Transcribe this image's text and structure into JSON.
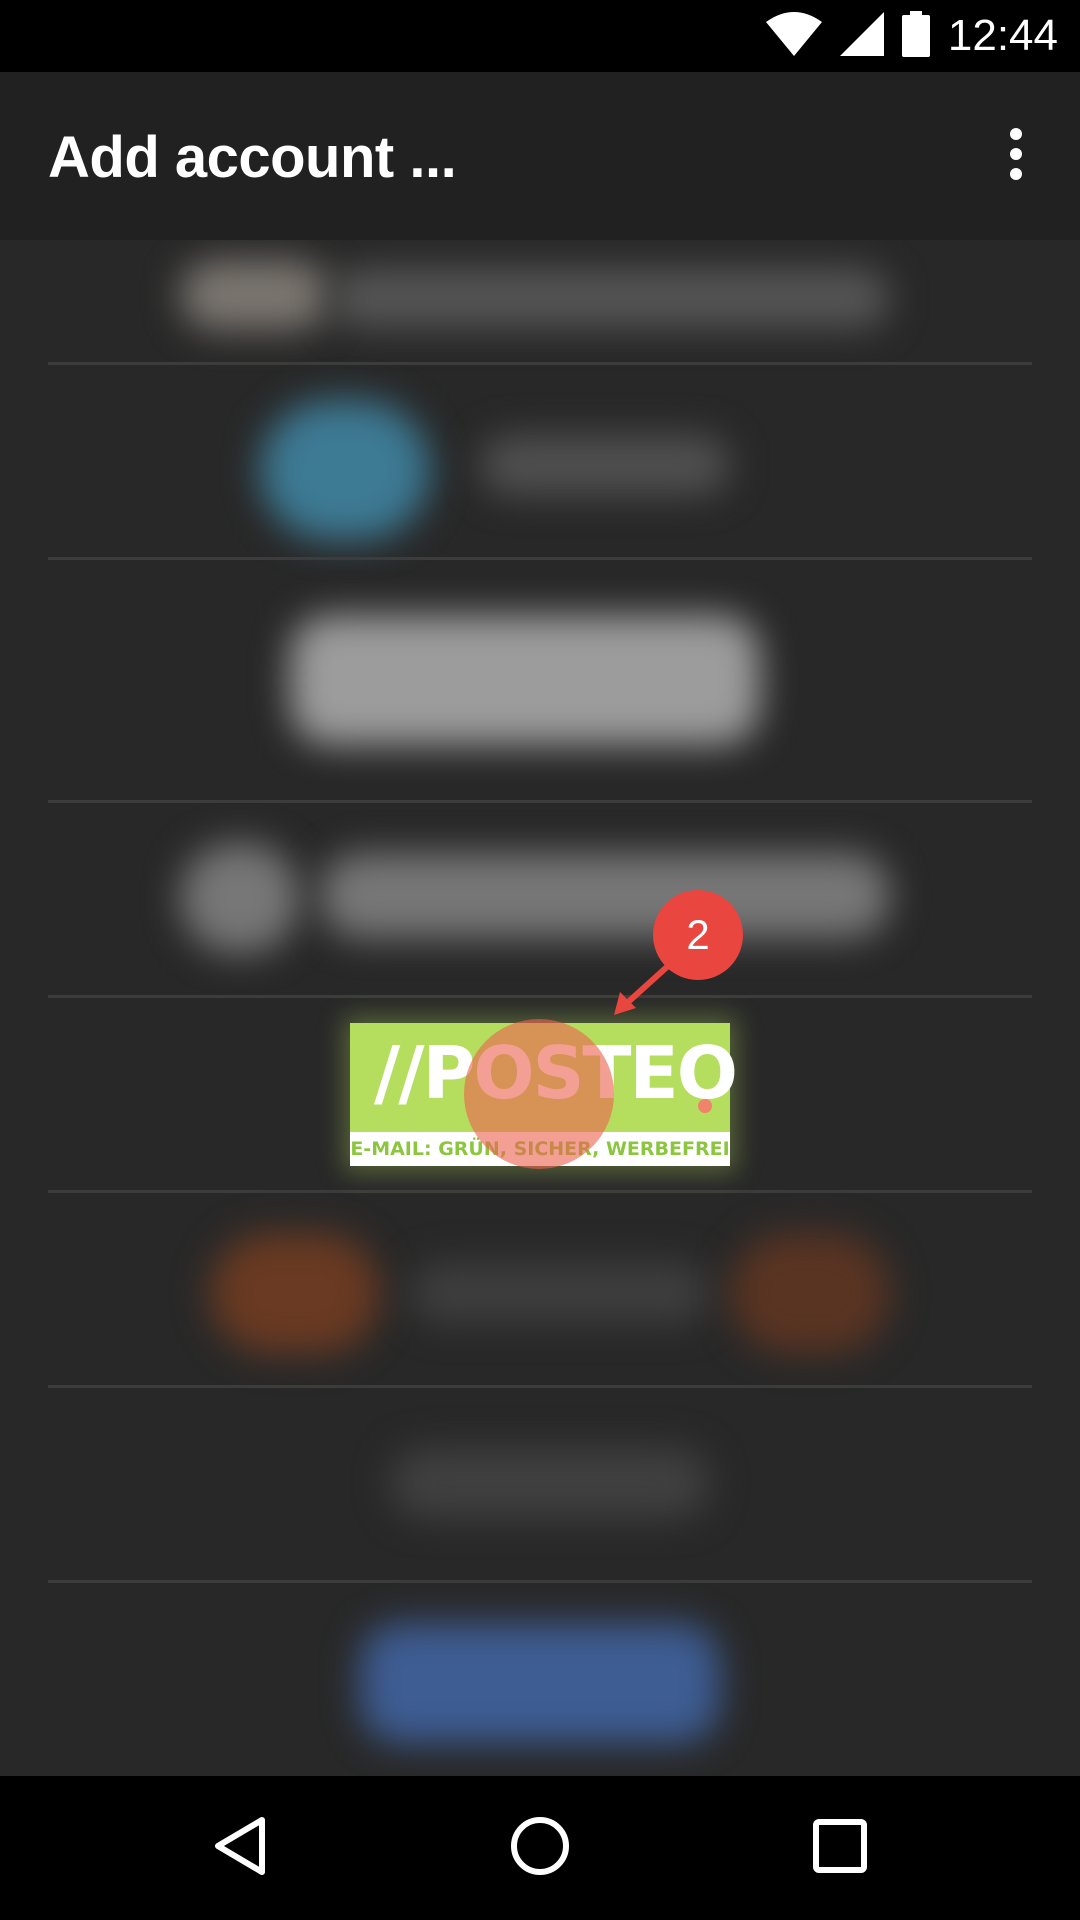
{
  "status_bar": {
    "time": "12:44",
    "icons": [
      "wifi-icon",
      "cell-signal-icon",
      "battery-icon"
    ]
  },
  "app_bar": {
    "title": "Add account ...",
    "overflow_icon": "more-vert-icon"
  },
  "account_list": {
    "highlighted_item": {
      "logo_word": "//POSTEO",
      "logo_tagline": "E-MAIL: GRÜN, SICHER, WERBEFREI"
    }
  },
  "annotation": {
    "step_number": "2",
    "colors": {
      "badge": "#e8463f",
      "tap": "#ec6450"
    }
  },
  "nav_bar": {
    "icons": [
      "back-icon",
      "home-icon",
      "recents-icon"
    ]
  },
  "colors": {
    "appbar": "#212121",
    "list_bg": "#282828",
    "posteo_green": "#b5dd5e"
  }
}
